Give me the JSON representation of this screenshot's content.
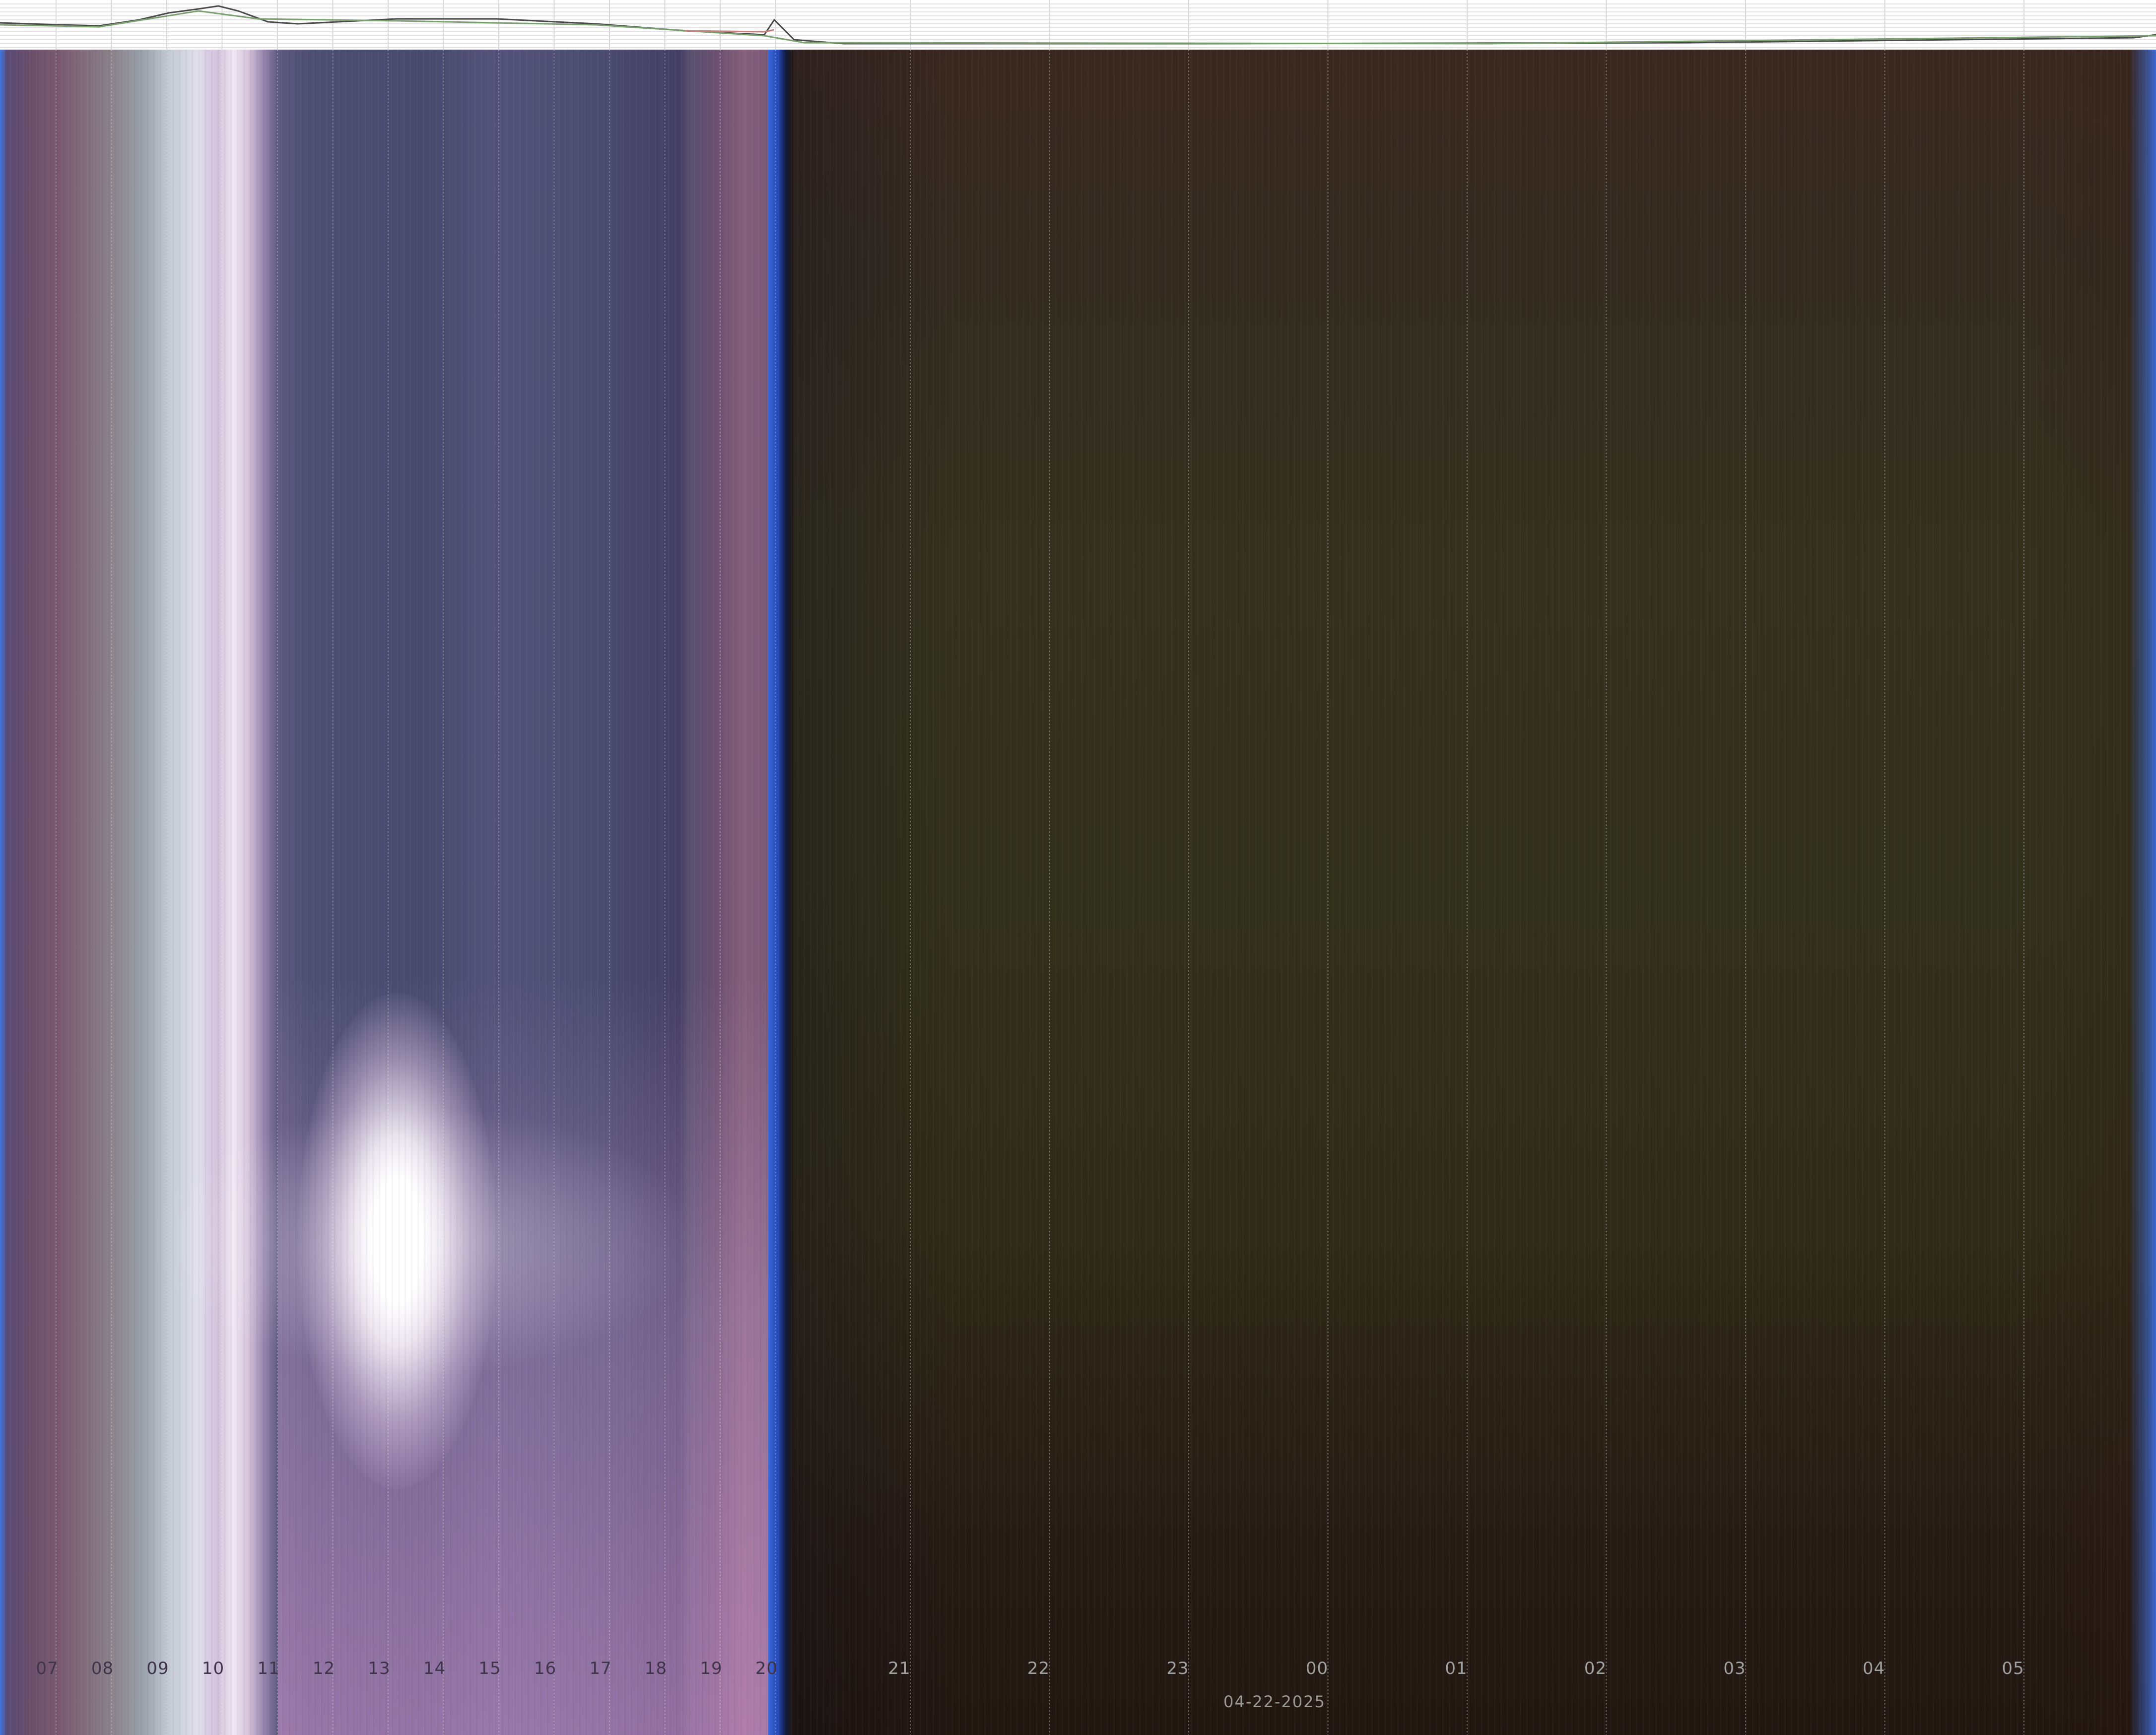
{
  "plot": {
    "background": "#ffffff",
    "grid_color": "#d8d8d8",
    "series_colors": [
      "#4a4a4a",
      "#7aa070",
      "#c08080"
    ]
  },
  "keogram": {
    "colors": {
      "day": "#4a4a70",
      "dawn_left": "#3e78e0",
      "sun": "#ffffff",
      "twilight": "#2448b8",
      "night_top": "#3a2820",
      "night_mid": "#31301b",
      "night_bottom": "#211610"
    }
  },
  "ticks": [
    "07",
    "08",
    "09",
    "10",
    "11",
    "12",
    "13",
    "14",
    "15",
    "16",
    "17",
    "18",
    "19",
    "20",
    "21",
    "22",
    "23",
    "00",
    "01",
    "02",
    "03",
    "04",
    "05"
  ],
  "date_label": "04-22-2025"
}
